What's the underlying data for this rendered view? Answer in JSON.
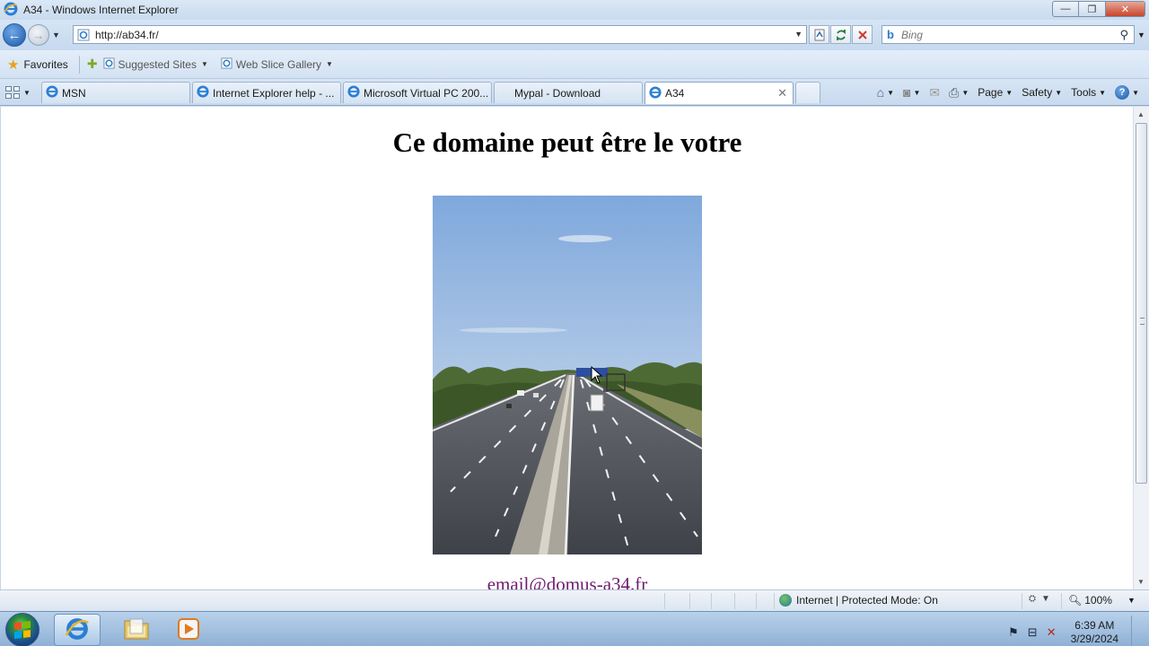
{
  "window": {
    "title": "A34 - Windows Internet Explorer",
    "minimize_label": "—",
    "restore_label": "❐",
    "close_label": "✕"
  },
  "address": {
    "url": "http://ab34.fr/",
    "compat_icon": "compat-view-icon",
    "refresh_icon": "refresh-icon",
    "stop_icon": "stop-icon"
  },
  "search": {
    "placeholder": "Bing",
    "provider_icon": "bing-icon"
  },
  "favorites_bar": {
    "favorites_label": "Favorites",
    "links": [
      {
        "label": "Suggested Sites"
      },
      {
        "label": "Web Slice Gallery"
      }
    ]
  },
  "tabs": [
    {
      "label": "MSN",
      "active": false
    },
    {
      "label": "Internet Explorer help - ...",
      "active": false
    },
    {
      "label": "Microsoft Virtual PC 200...",
      "active": false
    },
    {
      "label": "Mypal - Download",
      "active": false
    },
    {
      "label": "A34",
      "active": true
    }
  ],
  "command_bar": {
    "page_label": "Page",
    "safety_label": "Safety",
    "tools_label": "Tools",
    "help_label": "?"
  },
  "page": {
    "heading": "Ce domaine peut être le votre",
    "email": "email@domus-a34.fr",
    "image_desc_icon": "highway-photo"
  },
  "status_bar": {
    "zone": "Internet | Protected Mode: On",
    "zoom": "100%"
  },
  "taskbar": {
    "time": "6:39 AM",
    "date": "3/29/2024",
    "apps": [
      "internet-explorer",
      "file-explorer",
      "media-player"
    ]
  },
  "colors": {
    "link_visited": "#6d1a6d",
    "chrome_blue": "#cfe0f3"
  }
}
